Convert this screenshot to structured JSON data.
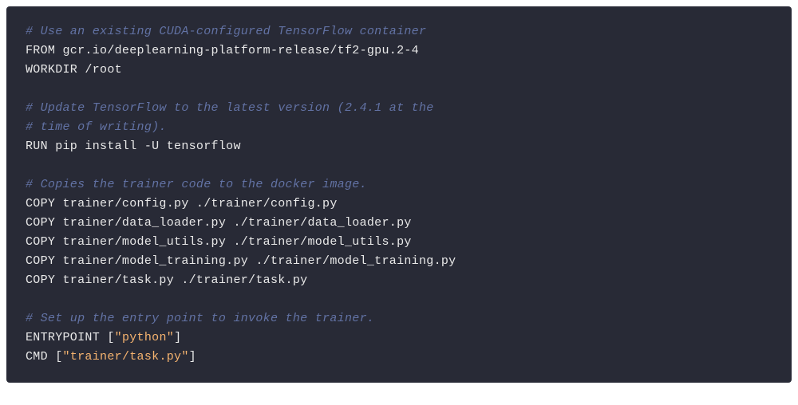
{
  "lines": [
    {
      "type": "comment",
      "text": "# Use an existing CUDA-configured TensorFlow container"
    },
    {
      "type": "plain",
      "text": "FROM gcr.io/deeplearning-platform-release/tf2-gpu.2-4"
    },
    {
      "type": "plain",
      "text": "WORKDIR /root"
    },
    {
      "type": "blank"
    },
    {
      "type": "comment",
      "text": "# Update TensorFlow to the latest version (2.4.1 at the"
    },
    {
      "type": "comment",
      "text": "# time of writing)."
    },
    {
      "type": "plain",
      "text": "RUN pip install -U tensorflow"
    },
    {
      "type": "blank"
    },
    {
      "type": "comment",
      "text": "# Copies the trainer code to the docker image."
    },
    {
      "type": "plain",
      "text": "COPY trainer/config.py ./trainer/config.py"
    },
    {
      "type": "plain",
      "text": "COPY trainer/data_loader.py ./trainer/data_loader.py"
    },
    {
      "type": "plain",
      "text": "COPY trainer/model_utils.py ./trainer/model_utils.py"
    },
    {
      "type": "plain",
      "text": "COPY trainer/model_training.py ./trainer/model_training.py"
    },
    {
      "type": "plain",
      "text": "COPY trainer/task.py ./trainer/task.py"
    },
    {
      "type": "blank"
    },
    {
      "type": "comment",
      "text": "# Set up the entry point to invoke the trainer."
    },
    {
      "type": "entrypoint",
      "keyword": "ENTRYPOINT ",
      "open": "[",
      "str": "\"python\"",
      "close": "]"
    },
    {
      "type": "cmd",
      "keyword": "CMD ",
      "open": "[",
      "str": "\"trainer/task.py\"",
      "close": "]"
    }
  ]
}
